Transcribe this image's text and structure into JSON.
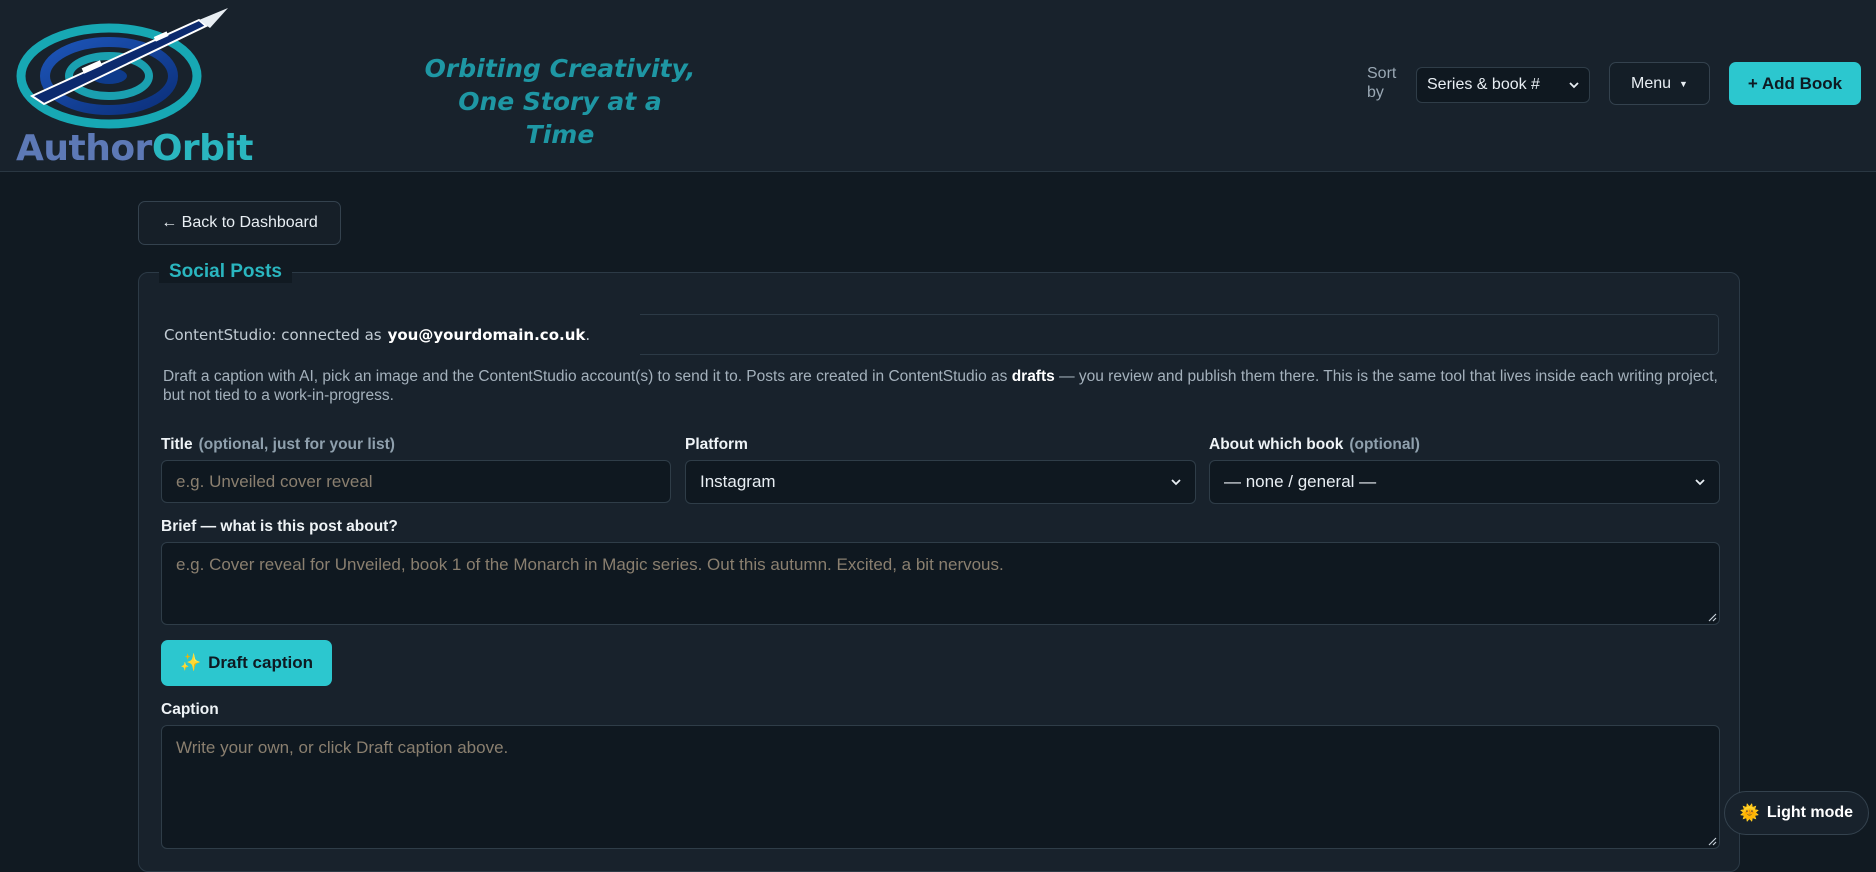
{
  "header": {
    "logo": {
      "word1": "Author",
      "word2": "Orbit"
    },
    "tagline": {
      "line1": "Orbiting Creativity,",
      "line2": "One Story at a Time"
    },
    "sort_label": "Sort by",
    "sort_value": "Series & book #",
    "menu_label": "Menu",
    "add_book_label": "+ Add Book"
  },
  "back_label": "← Back to Dashboard",
  "panel": {
    "title": "Social Posts",
    "connected_prefix": "ContentStudio: connected as",
    "connected_email": "you@yourdomain.co.uk",
    "connected_suffix": ".",
    "desc_part1": "Draft a caption with AI, pick an image and the ContentStudio account(s) to send it to. Posts are created in ContentStudio as ",
    "desc_bold": "drafts",
    "desc_part2": " — you review and publish them there. This is the same tool that lives inside each writing project, but not tied to a work-in-progress.",
    "title_label": "Title",
    "title_hint": "(optional, just for your list)",
    "title_placeholder": "e.g. Unveiled cover reveal",
    "platform_label": "Platform",
    "platform_value": "Instagram",
    "book_label": "About which book",
    "book_hint": "(optional)",
    "book_value": "— none / general —",
    "brief_label": "Brief — what is this post about?",
    "brief_placeholder": "e.g. Cover reveal for Unveiled, book 1 of the Monarch in Magic series. Out this autumn. Excited, a bit nervous.",
    "draft_button": "Draft caption",
    "draft_icon": "✨",
    "caption_label": "Caption",
    "caption_placeholder": "Write your own, or click Draft caption above."
  },
  "theme_toggle": {
    "icon": "🌞",
    "label": "Light mode"
  },
  "colors": {
    "accent": "#2cc7cf",
    "background": "#111a22",
    "panel": "#18222c"
  }
}
